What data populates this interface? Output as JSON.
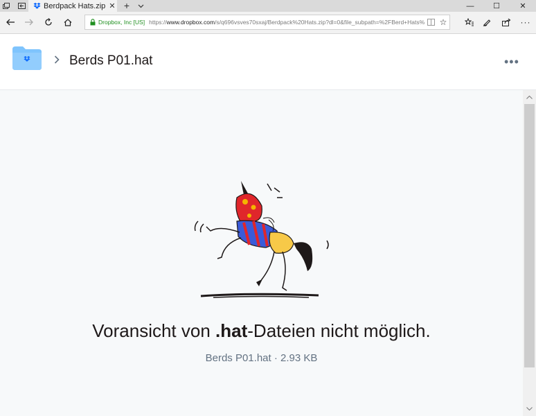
{
  "browser": {
    "tab": {
      "title": "Berdpack Hats.zip"
    },
    "address": {
      "site_identity": "Dropbox, Inc [US]",
      "url_scheme": "https://",
      "url_host": "www.dropbox.com",
      "url_path": "/s/q696vsves70sxaj/Berdpack%20Hats.zip?dl=0&file_subpath=%2FBerd+Hats%"
    }
  },
  "header": {
    "file_name": "Berds P01.hat"
  },
  "preview": {
    "message_prefix": "Voransicht von ",
    "message_ext": ".hat",
    "message_suffix": "-Dateien nicht möglich.",
    "file_meta": "Berds P01.hat · 2.93 KB"
  },
  "colors": {
    "dropbox_blue": "#0061fe",
    "folder_blue": "#7fc4fd",
    "text_primary": "#1e1919",
    "text_secondary": "#637282",
    "secure_green": "#1f8f1f"
  }
}
